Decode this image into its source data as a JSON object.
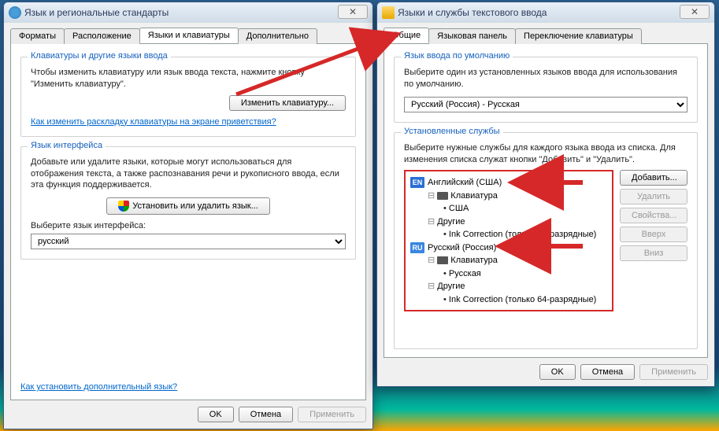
{
  "window1": {
    "title": "Язык и региональные стандарты",
    "tabs": [
      "Форматы",
      "Расположение",
      "Языки и клавиатуры",
      "Дополнительно"
    ],
    "active_tab": 2,
    "group_kb": {
      "title": "Клавиатуры и другие языки ввода",
      "desc": "Чтобы изменить клавиатуру или язык ввода текста, нажмите кнопку \"Изменить клавиатуру\".",
      "btn": "Изменить клавиатуру...",
      "link": "Как изменить раскладку клавиатуры на экране приветствия?"
    },
    "group_ui": {
      "title": "Язык интерфейса",
      "desc": "Добавьте или удалите языки, которые могут использоваться для отображения текста, а также распознавания речи и рукописного ввода, если эта функция поддерживается.",
      "install_btn": "Установить или удалить язык...",
      "select_label": "Выберите язык интерфейса:",
      "select_value": "русский"
    },
    "footer_link": "Как установить дополнительный язык?",
    "buttons": {
      "ok": "OK",
      "cancel": "Отмена",
      "apply": "Применить"
    }
  },
  "window2": {
    "title": "Языки и службы текстового ввода",
    "tabs": [
      "Общие",
      "Языковая панель",
      "Переключение клавиатуры"
    ],
    "active_tab": 0,
    "group_def": {
      "title": "Язык ввода по умолчанию",
      "desc": "Выберите один из установленных языков ввода для использования по умолчанию.",
      "select_value": "Русский (Россия) - Русская"
    },
    "group_serv": {
      "title": "Установленные службы",
      "desc": "Выберите нужные службы для каждого языка ввода из списка. Для изменения списка служат кнопки \"Добавить\" и \"Удалить\".",
      "tree": {
        "en": {
          "badge": "EN",
          "label": "Английский (США)",
          "keyboard": "Клавиатура",
          "layout": "США",
          "other": "Другие",
          "ink": "Ink Correction (только 64-разрядные)"
        },
        "ru": {
          "badge": "RU",
          "label": "Русский (Россия)",
          "keyboard": "Клавиатура",
          "layout": "Русская",
          "other": "Другие",
          "ink": "Ink Correction (только 64-разрядные)"
        }
      },
      "side": {
        "add": "Добавить...",
        "remove": "Удалить",
        "props": "Свойства...",
        "up": "Вверх",
        "down": "Вниз"
      }
    },
    "buttons": {
      "ok": "OK",
      "cancel": "Отмена",
      "apply": "Применить"
    }
  }
}
